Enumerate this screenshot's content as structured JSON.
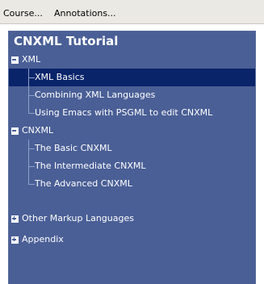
{
  "menubar": {
    "course_label": "Course...",
    "annotations_label": "Annotations..."
  },
  "panel": {
    "title": "CNXML Tutorial"
  },
  "tree": {
    "xml": {
      "label": "XML",
      "state": "expanded",
      "children": [
        {
          "label": "XML Basics",
          "selected": true
        },
        {
          "label": "Combining XML Languages"
        },
        {
          "label": "Using Emacs with PSGML to edit CNXML"
        }
      ]
    },
    "cnxml": {
      "label": "CNXML",
      "state": "expanded",
      "children": [
        {
          "label": "The Basic CNXML"
        },
        {
          "label": "The Intermediate CNXML"
        },
        {
          "label": "The Advanced CNXML"
        }
      ]
    },
    "other": {
      "label": "Other Markup Languages",
      "state": "collapsed"
    },
    "appendix": {
      "label": "Appendix",
      "state": "collapsed"
    }
  },
  "colors": {
    "panel_bg": "#4a5f96",
    "selected_bg": "#0a246a",
    "menubar_bg": "#ebe9e3",
    "text_light": "#ffffff"
  }
}
